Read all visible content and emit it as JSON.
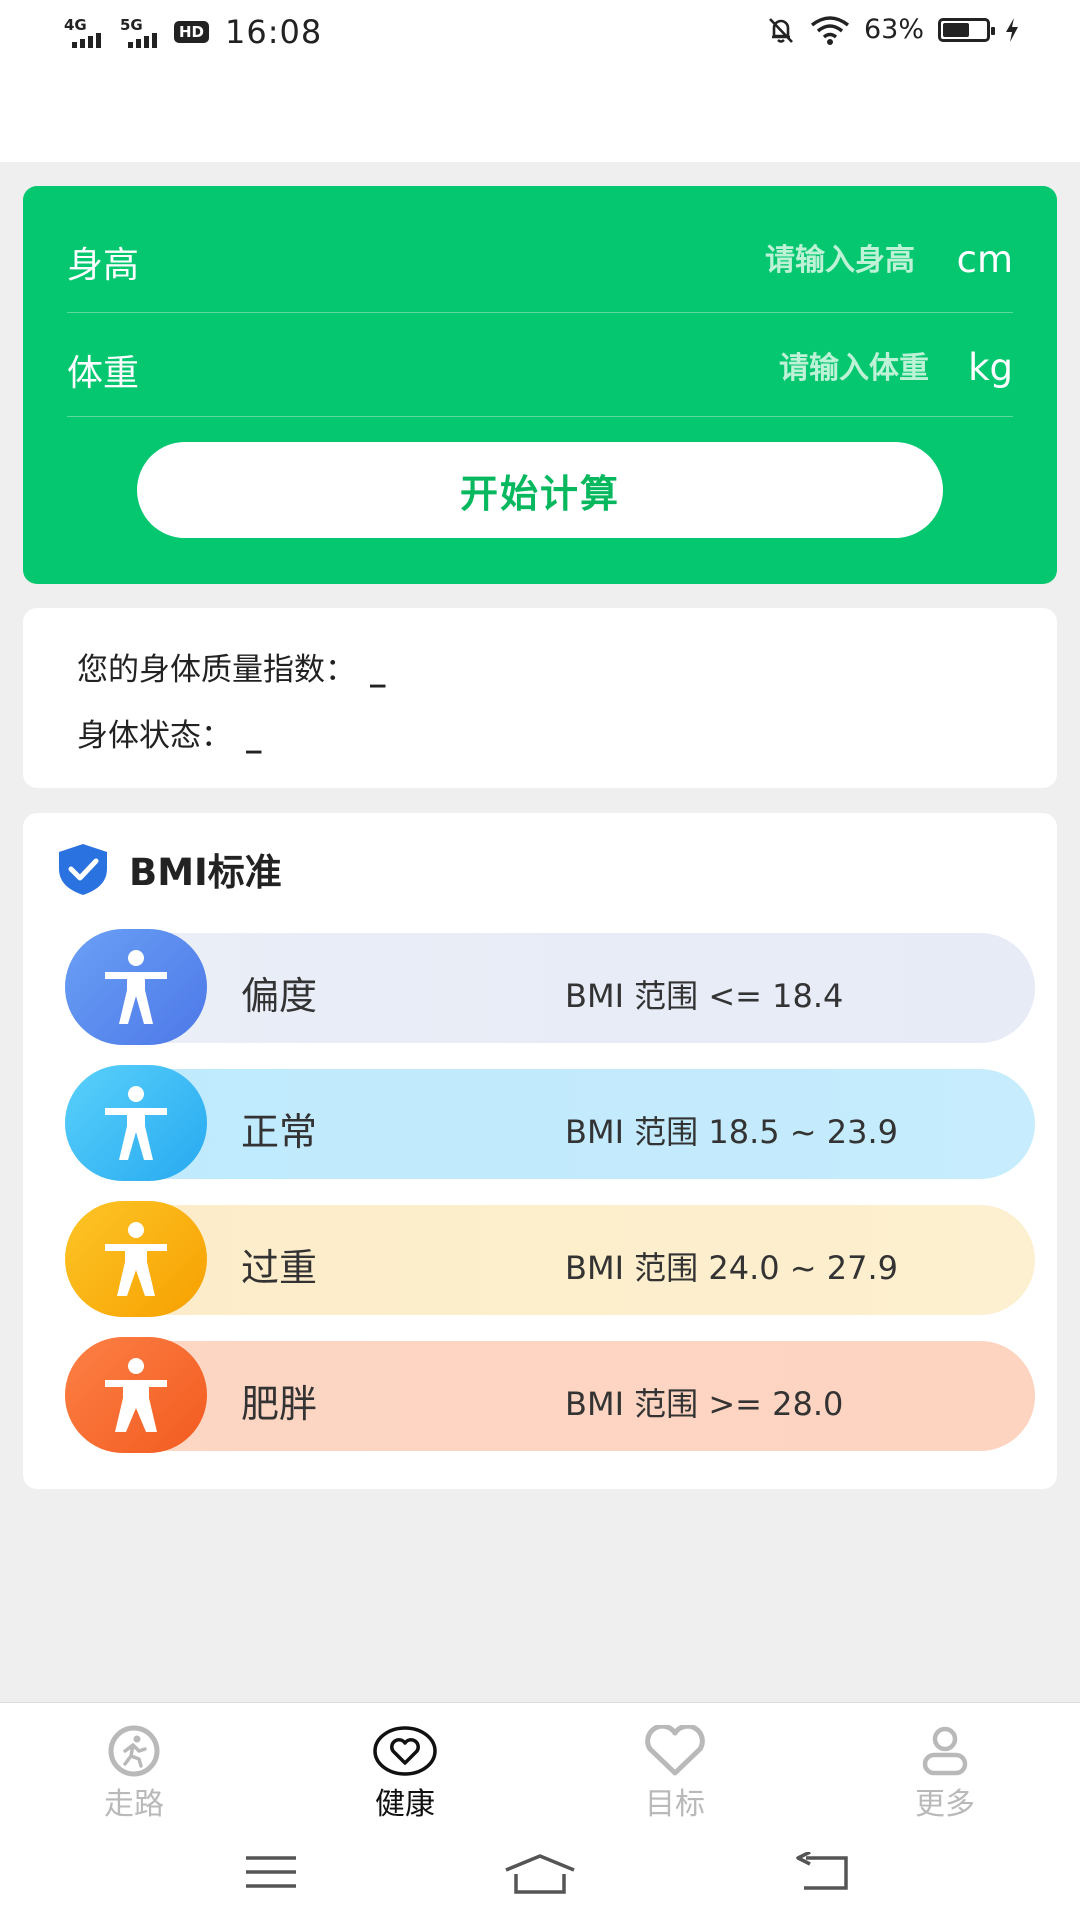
{
  "status_bar": {
    "network1": "4G",
    "network2": "5G",
    "hd": "HD",
    "time": "16:08",
    "battery_pct": "63%",
    "battery_level": 0.63
  },
  "form": {
    "height_label": "身高",
    "height_placeholder": "请输入身高",
    "height_unit": "cm",
    "weight_label": "体重",
    "weight_placeholder": "请输入体重",
    "weight_unit": "kg",
    "calc_button": "开始计算"
  },
  "result": {
    "bmi_label": "您的身体质量指数：",
    "bmi_value": "_",
    "status_label": "身体状态：",
    "status_value": "_"
  },
  "bmi_standard": {
    "title": "BMI标准",
    "levels": [
      {
        "name": "偏度",
        "range": "BMI 范围 <= 18.4"
      },
      {
        "name": "正常",
        "range": "BMI 范围 18.5 ~ 23.9"
      },
      {
        "name": "过重",
        "range": "BMI 范围 24.0 ~ 27.9"
      },
      {
        "name": "肥胖",
        "range": "BMI 范围 >= 28.0"
      }
    ]
  },
  "bottom_nav": {
    "tabs": [
      {
        "label": "走路",
        "icon": "walk-icon"
      },
      {
        "label": "健康",
        "icon": "heart-icon"
      },
      {
        "label": "目标",
        "icon": "heart-outline-icon"
      },
      {
        "label": "更多",
        "icon": "person-icon"
      }
    ],
    "active": "健康"
  },
  "colors": {
    "brand_green": "#05c770",
    "level_thin": "#5b8ef0",
    "level_normal": "#3cc0f7",
    "level_over": "#fdb300",
    "level_obese": "#fb6a2b"
  }
}
